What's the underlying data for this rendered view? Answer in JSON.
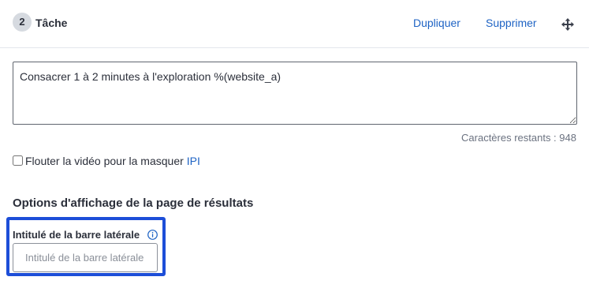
{
  "task": {
    "step_number": "2",
    "title": "Tâche",
    "duplicate_label": "Dupliquer",
    "delete_label": "Supprimer",
    "move_icon": "move-arrows-icon",
    "instruction_text": "Consacrer 1 à 2 minutes à l'exploration %(website_a)",
    "chars_remaining_label": "Caractères restants :",
    "chars_remaining_value": "948"
  },
  "blur_option": {
    "checked": false,
    "label": "Flouter la vidéo pour la masquer",
    "link_text": "IPI"
  },
  "results_display": {
    "heading": "Options d'affichage de la page de résultats",
    "sidebar_label": {
      "label": "Intitulé de la barre latérale",
      "info_icon": "info-icon",
      "value": "",
      "placeholder": "Intitulé de la barre latérale"
    }
  },
  "colors": {
    "link": "#1e63c4",
    "highlight": "#1d4ed8",
    "badge_bg": "#d6dae0",
    "text": "#2b2f3a",
    "muted": "#6b7280"
  }
}
